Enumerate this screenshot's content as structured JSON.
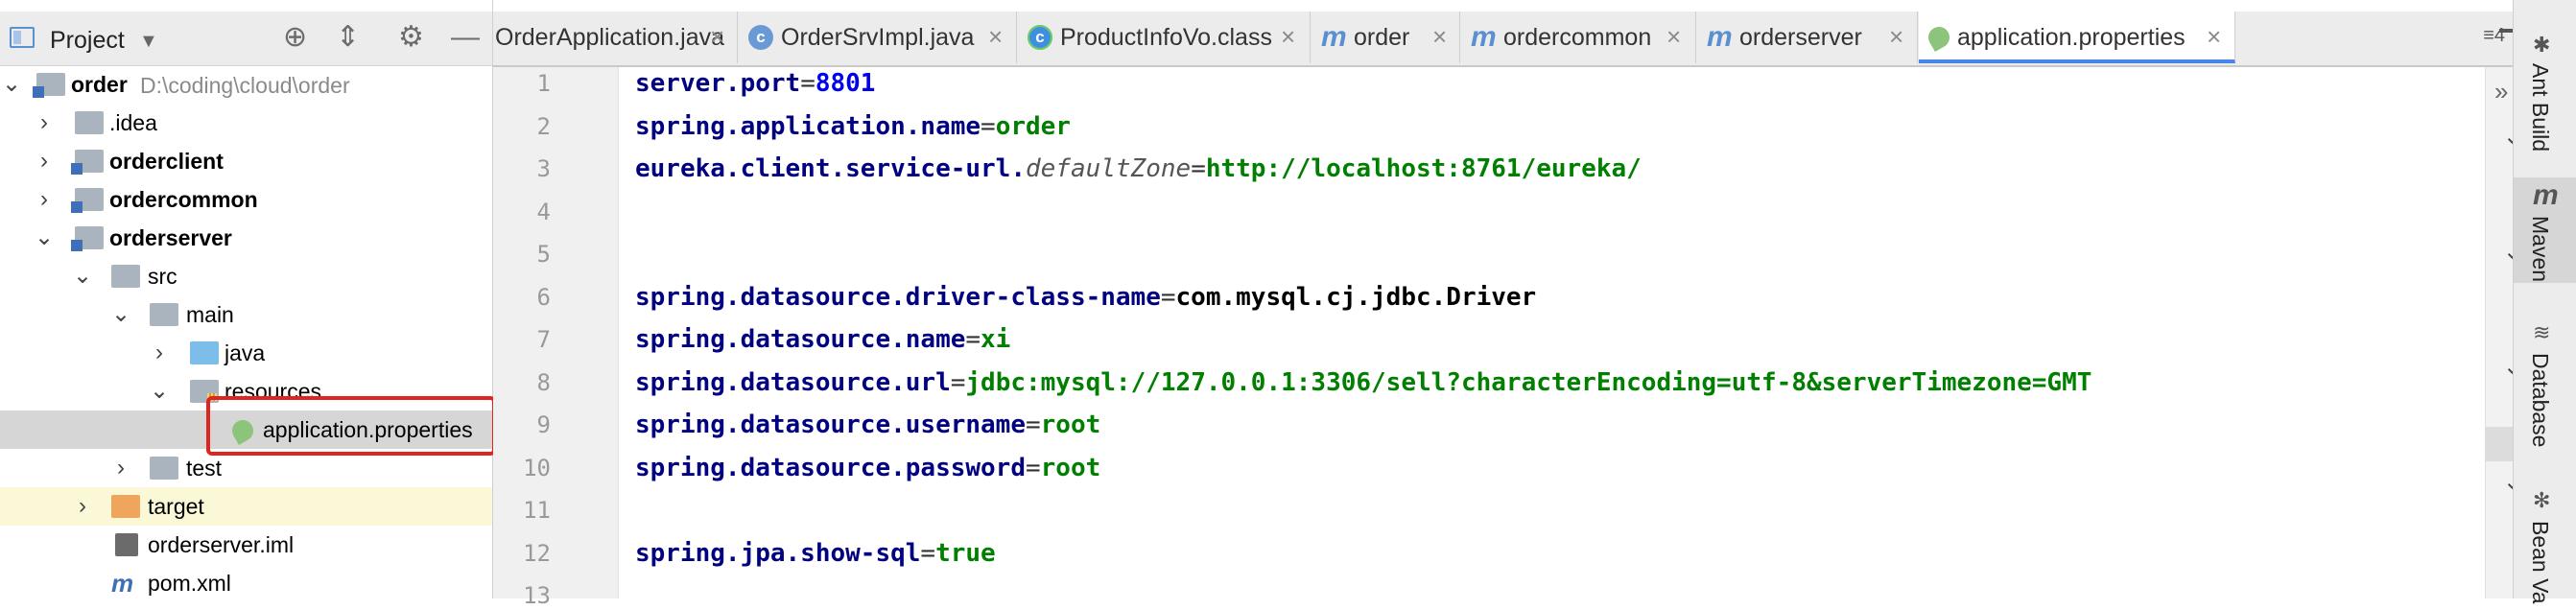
{
  "project": {
    "title": "Project",
    "tree": [
      {
        "label": "order",
        "path": "D:\\coding\\cloud\\order",
        "bold": true
      },
      {
        "label": ".idea"
      },
      {
        "label": "orderclient",
        "bold": true
      },
      {
        "label": "ordercommon",
        "bold": true
      },
      {
        "label": "orderserver",
        "bold": true
      },
      {
        "label": "src"
      },
      {
        "label": "main"
      },
      {
        "label": "java"
      },
      {
        "label": "resources"
      },
      {
        "label": "application.properties"
      },
      {
        "label": "test"
      },
      {
        "label": "target"
      },
      {
        "label": "orderserver.iml"
      },
      {
        "label": "pom.xml"
      }
    ]
  },
  "tabs": [
    {
      "label": "OrderApplication.java",
      "icon": "class-icon"
    },
    {
      "label": "OrderSrvImpl.java",
      "icon": "class-icon"
    },
    {
      "label": "ProductInfoVo.class",
      "icon": "compiled-class-icon"
    },
    {
      "label": "order",
      "icon": "maven-icon"
    },
    {
      "label": "ordercommon",
      "icon": "maven-icon"
    },
    {
      "label": "orderserver",
      "icon": "maven-icon"
    },
    {
      "label": "application.properties",
      "icon": "spring-properties-icon",
      "active": true
    }
  ],
  "tab_overflow": "≡4",
  "editor": {
    "lines": [
      {
        "no": "1",
        "key": "server.port",
        "eq": "=",
        "value": "8801",
        "numeric": true
      },
      {
        "no": "2",
        "key": "spring.application.name",
        "eq": "=",
        "value": "order"
      },
      {
        "no": "3",
        "key": "eureka.client.service-url.",
        "key_italic": "defaultZone",
        "eq": "=",
        "value": "http://localhost:8761/eureka/"
      },
      {
        "no": "4"
      },
      {
        "no": "5"
      },
      {
        "no": "6",
        "key": "spring.datasource.driver-class-name",
        "eq": "=",
        "value": "com.mysql.cj.jdbc.Driver",
        "value_dark": true
      },
      {
        "no": "7",
        "key": "spring.datasource.name",
        "eq": "=",
        "value": "xi"
      },
      {
        "no": "8",
        "key": "spring.datasource.url",
        "eq": "=",
        "value": "jdbc:mysql://127.0.0.1:3306/sell?characterEncoding=utf-8&serverTimezone=GMT"
      },
      {
        "no": "9",
        "key": "spring.datasource.username",
        "eq": "=",
        "value": "root"
      },
      {
        "no": "10",
        "key": "spring.datasource.password",
        "eq": "=",
        "value": "root"
      },
      {
        "no": "11"
      },
      {
        "no": "12",
        "key": "spring.jpa.show-sql",
        "eq": "=",
        "value": "true"
      },
      {
        "no": "13"
      }
    ]
  },
  "right_tools": [
    "Ant Build",
    "Maven",
    "Database",
    "Bean Va"
  ],
  "colors": {
    "key": "#000080",
    "value": "#007f00",
    "number": "#0000ee",
    "highlight": "#e02420",
    "active_tab": "#4a86e8"
  }
}
